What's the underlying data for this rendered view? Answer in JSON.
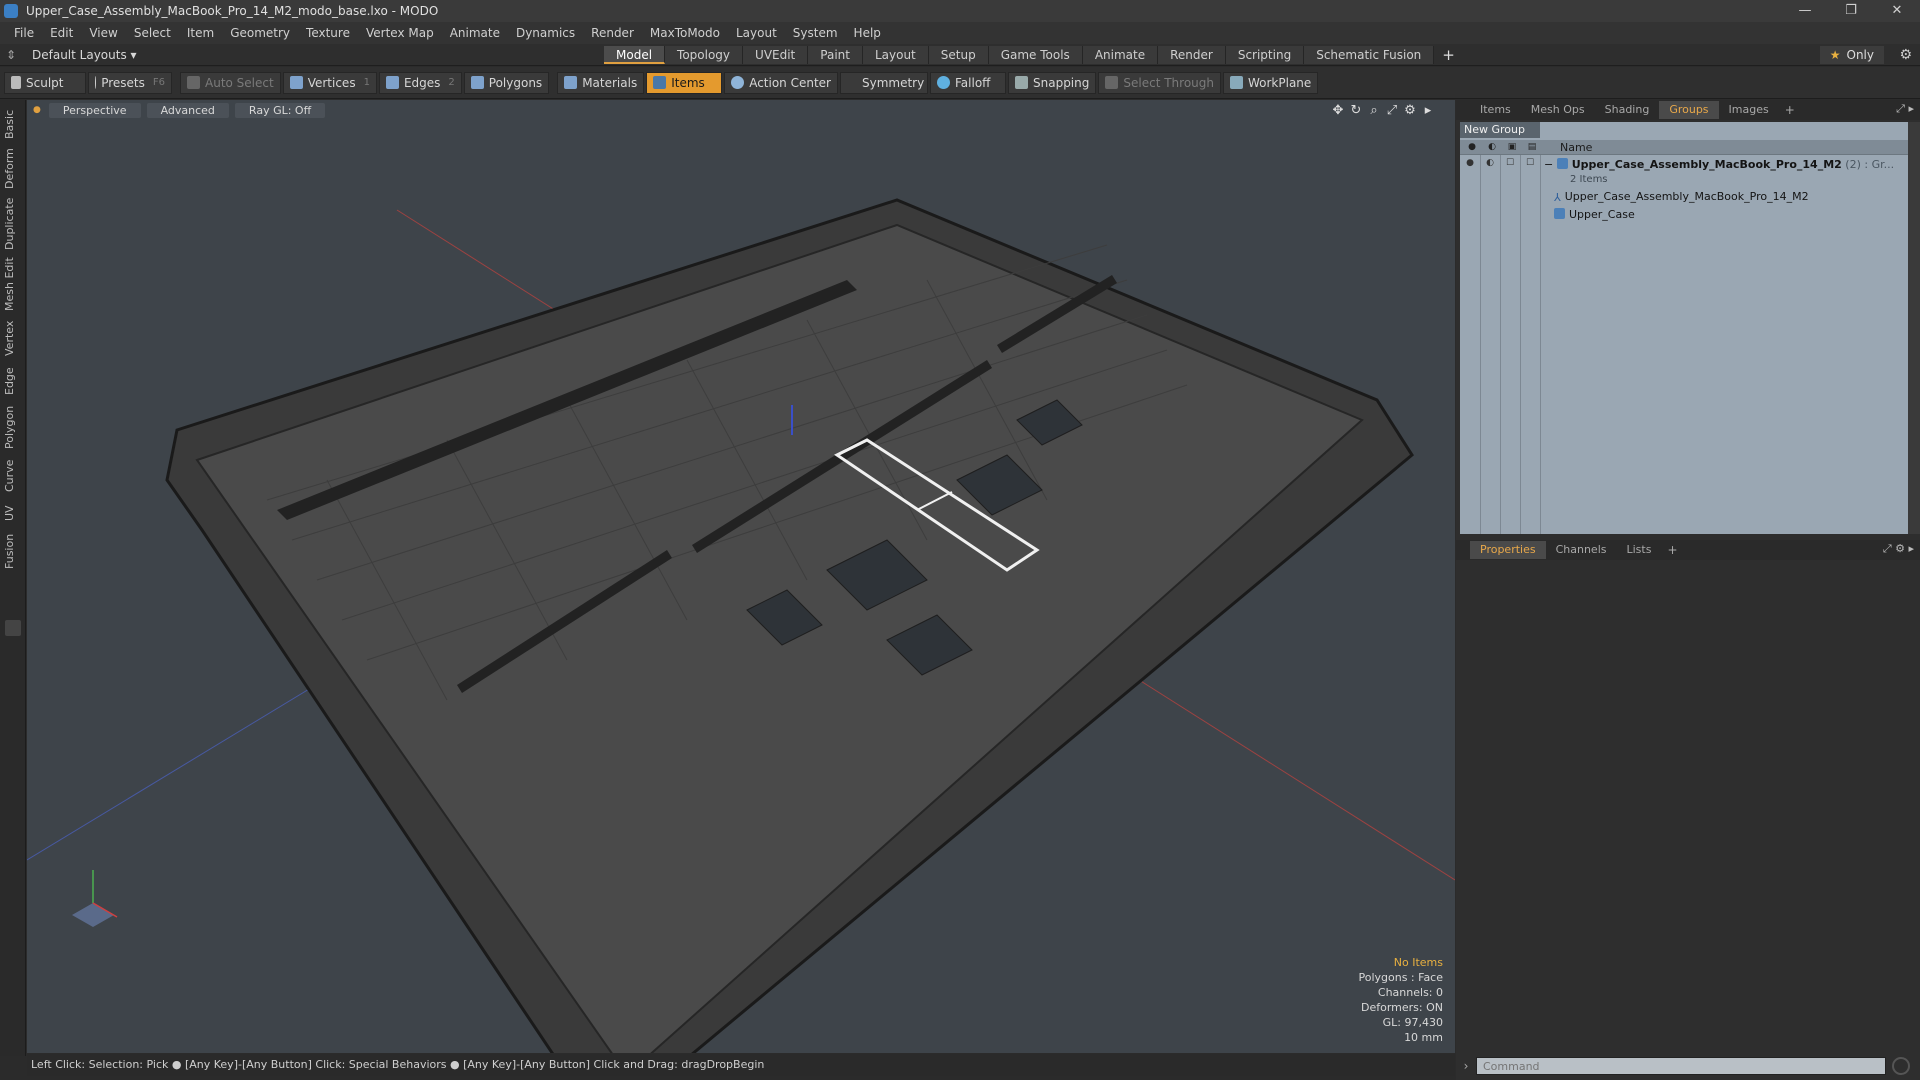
{
  "window": {
    "title": "Upper_Case_Assembly_MacBook_Pro_14_M2_modo_base.lxo - MODO",
    "controls": [
      "—",
      "❐",
      "✕"
    ]
  },
  "menu": [
    "File",
    "Edit",
    "View",
    "Select",
    "Item",
    "Geometry",
    "Texture",
    "Vertex Map",
    "Animate",
    "Dynamics",
    "Render",
    "MaxToModo",
    "Layout",
    "System",
    "Help"
  ],
  "layout": {
    "selector": "Default Layouts ▾",
    "tabs": [
      "Model",
      "Topology",
      "UVEdit",
      "Paint",
      "Layout",
      "Setup",
      "Game Tools",
      "Animate",
      "Render",
      "Scripting",
      "Schematic Fusion"
    ],
    "active_tab": "Model",
    "add": "+",
    "only": "Only"
  },
  "toolbar": {
    "sculpt": "Sculpt",
    "presets": "Presets",
    "presets_key": "F6",
    "auto_select": "Auto Select",
    "vertices": "Vertices",
    "vertices_count": "1",
    "edges": "Edges",
    "edges_count": "2",
    "polygons": "Polygons",
    "materials": "Materials",
    "items": "Items",
    "action_center": "Action Center",
    "symmetry": "Symmetry",
    "falloff": "Falloff",
    "snapping": "Snapping",
    "select_through": "Select Through",
    "workplane": "WorkPlane"
  },
  "left_tabs": [
    "Basic",
    "Deform",
    "Duplicate",
    "Mesh Edit",
    "Vertex",
    "Edge",
    "Polygon",
    "Curve",
    "UV",
    "Fusion"
  ],
  "viewport": {
    "view": "Perspective",
    "shading": "Advanced",
    "raygl": "Ray GL: Off",
    "info": {
      "no_items": "No Items",
      "polygons": "Polygons : Face",
      "channels": "Channels: 0",
      "deformers": "Deformers: ON",
      "gl": "GL: 97,430",
      "unit": "10 mm"
    }
  },
  "status_bar": "Left Click: Selection: Pick ● [Any Key]-[Any Button] Click: Special Behaviors ● [Any Key]-[Any Button] Click and Drag: dragDropBegin",
  "right_panel": {
    "top_tabs": [
      "Items",
      "Mesh Ops",
      "Shading",
      "Groups",
      "Images"
    ],
    "top_active": "Groups",
    "new_group": "New Group",
    "column_name": "Name",
    "rows": {
      "group_name": "Upper_Case_Assembly_MacBook_Pro_14_M2",
      "group_suffix": "(2) : Gr...",
      "group_sub": "2 Items",
      "child1": "Upper_Case_Assembly_MacBook_Pro_14_M2",
      "child2": "Upper_Case"
    },
    "bottom_tabs": [
      "Properties",
      "Channels",
      "Lists"
    ],
    "bottom_active": "Properties",
    "command_placeholder": "Command"
  },
  "colors": {
    "accent": "#e49a2e",
    "viewport_bg": "#3e444a",
    "groups_bg": "#9aa7b3"
  }
}
